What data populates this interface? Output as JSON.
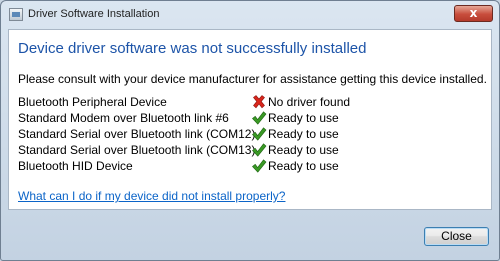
{
  "window": {
    "title": "Driver Software Installation",
    "close_glyph": "x"
  },
  "heading": "Device driver software was not successfully installed",
  "message": "Please consult with your device manufacturer for assistance getting this device installed.",
  "devices": [
    {
      "name": "Bluetooth Peripheral Device",
      "status": "No driver found",
      "status_icon": "error-x-icon"
    },
    {
      "name": "Standard Modem over Bluetooth link #6",
      "status": "Ready to use",
      "status_icon": "checkmark-icon"
    },
    {
      "name": "Standard Serial over Bluetooth link (COM12)",
      "status": "Ready to use",
      "status_icon": "checkmark-icon"
    },
    {
      "name": "Standard Serial over Bluetooth link (COM13)",
      "status": "Ready to use",
      "status_icon": "checkmark-icon"
    },
    {
      "name": "Bluetooth HID Device",
      "status": "Ready to use",
      "status_icon": "checkmark-icon"
    }
  ],
  "help_link": "What can I do if my device did not install properly?",
  "close_button": "Close",
  "colors": {
    "heading": "#1d54a8",
    "link": "#0b64c8",
    "error": "#d9261c",
    "success": "#3a9a25"
  }
}
